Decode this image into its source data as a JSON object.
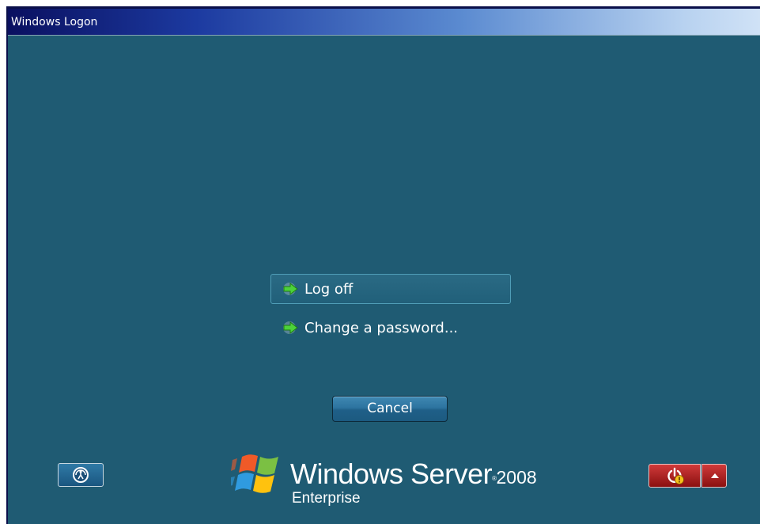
{
  "window": {
    "title": "Windows Logon"
  },
  "options": [
    {
      "label": "Log off",
      "icon": "green-arrow-icon",
      "selected": true
    },
    {
      "label": "Change a password...",
      "icon": "green-arrow-icon",
      "selected": false
    }
  ],
  "cancel_label": "Cancel",
  "branding": {
    "product": "Windows Server",
    "registered_mark": "®",
    "version": "2008",
    "edition": "Enterprise"
  },
  "buttons": {
    "ease_of_access_icon": "ease-of-access-icon",
    "shutdown_icon": "shutdown-warning-icon",
    "shutdown_options_icon": "caret-up-icon"
  },
  "colors": {
    "background": "#1f5b73",
    "arrow_green": "#4cd23a",
    "shutdown_red": "#b02020"
  }
}
